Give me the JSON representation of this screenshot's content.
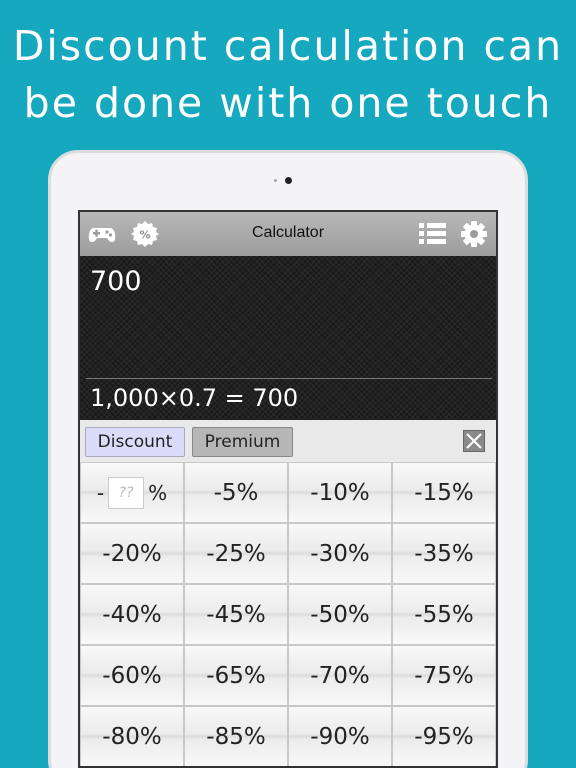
{
  "headline": {
    "line1": "Discount calculation can",
    "line2": "be done with one touch"
  },
  "app": {
    "title": "Calculator",
    "icons": {
      "left": [
        "gamepad-icon",
        "discount-badge-icon"
      ],
      "right": [
        "list-icon",
        "gear-icon"
      ]
    },
    "badge_text": "%"
  },
  "display": {
    "result": "700",
    "expression": "1,000×0.7 = 700"
  },
  "tabs": {
    "discount_label": "Discount",
    "premium_label": "Premium",
    "active": "Discount"
  },
  "custom_key": {
    "prefix": "-",
    "placeholder": "??",
    "suffix": "%"
  },
  "keys": [
    "-5%",
    "-10%",
    "-15%",
    "-20%",
    "-25%",
    "-30%",
    "-35%",
    "-40%",
    "-45%",
    "-50%",
    "-55%",
    "-60%",
    "-65%",
    "-70%",
    "-75%",
    "-80%",
    "-85%",
    "-90%",
    "-95%"
  ],
  "colors": {
    "background": "#16a8be",
    "display": "#181818",
    "active_tab": "#dcdcfa"
  }
}
